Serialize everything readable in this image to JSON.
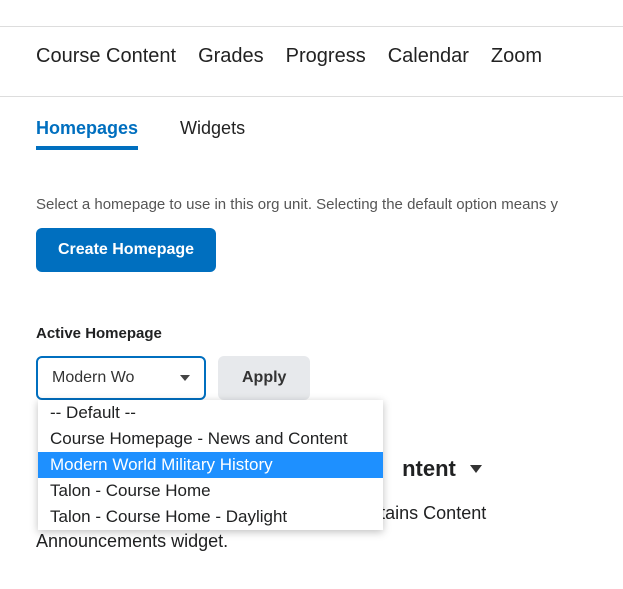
{
  "mainNav": {
    "items": [
      "Course Content",
      "Grades",
      "Progress",
      "Calendar",
      "Zoom"
    ]
  },
  "subNav": {
    "homepages": "Homepages",
    "widgets": "Widgets"
  },
  "description": "Select a homepage to use in this org unit. Selecting the default option means y",
  "createButton": "Create Homepage",
  "activeHomepageLabel": "Active Homepage",
  "dropdown": {
    "displayValue": "Modern Wo",
    "options": [
      "-- Default --",
      "Course Homepage - News and Content",
      "Modern World Military History",
      "Talon - Course Home",
      "Talon - Course Home - Daylight"
    ],
    "selectedIndex": 2
  },
  "applyButton": "Apply",
  "backgroundHeading": "ntent",
  "backgroundBody": {
    "line1": "lumn contains Content",
    "line2": "Announcements widget."
  }
}
